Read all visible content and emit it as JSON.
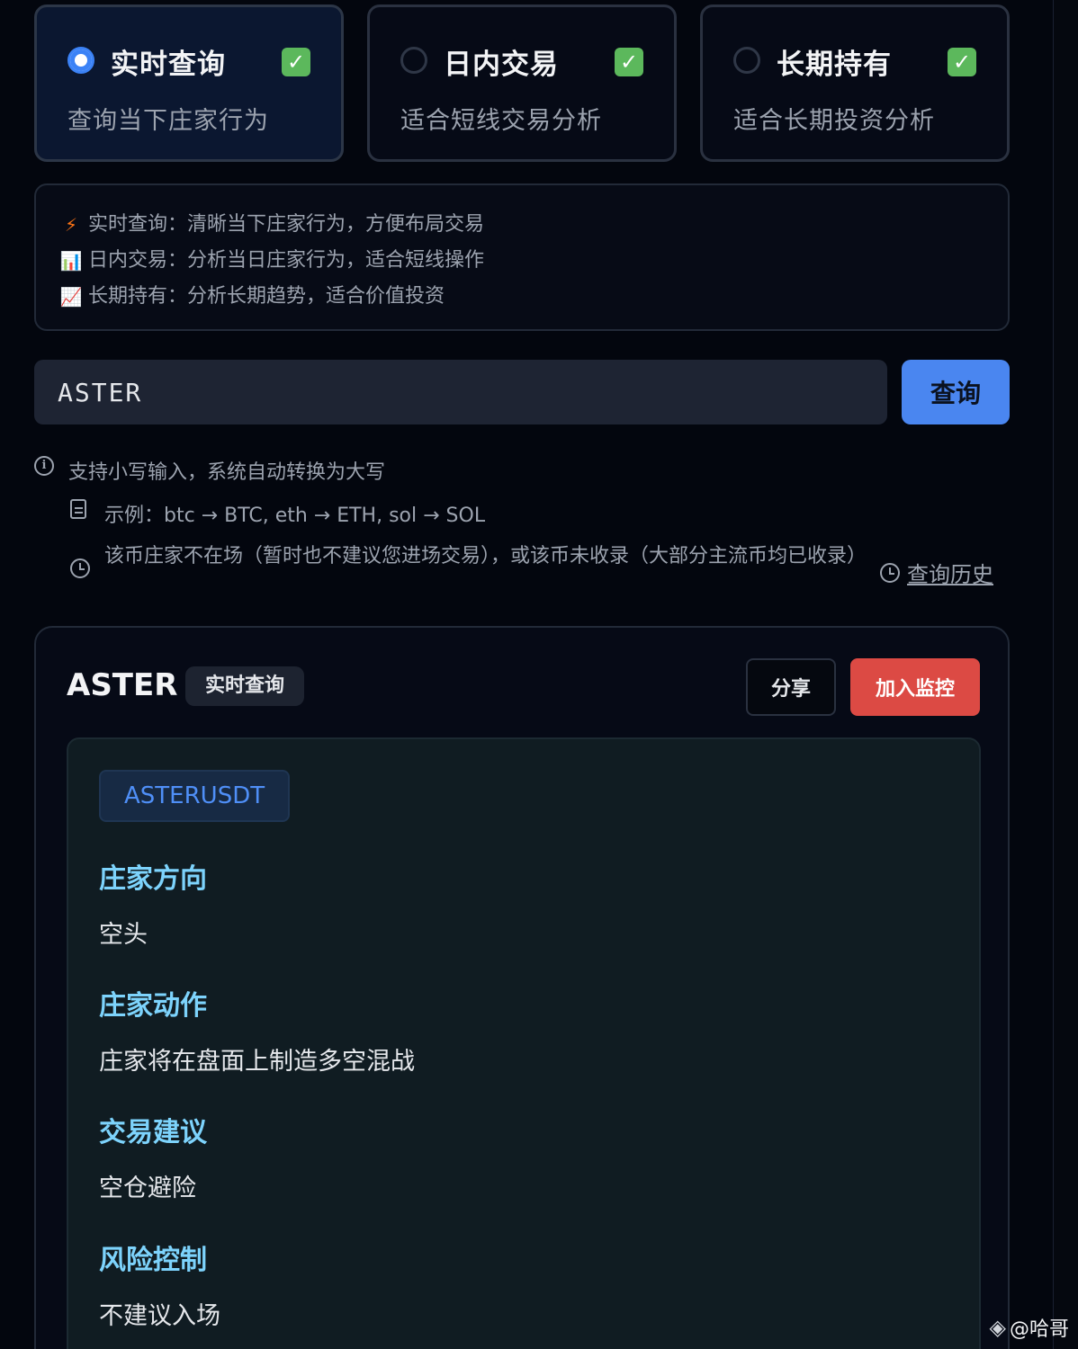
{
  "modes": [
    {
      "title": "实时查询",
      "subtitle": "查询当下庄家行为",
      "check": "✓",
      "selected": true
    },
    {
      "title": "日内交易",
      "subtitle": "适合短线交易分析",
      "check": "✓",
      "selected": false
    },
    {
      "title": "长期持有",
      "subtitle": "适合长期投资分析",
      "check": "✓",
      "selected": false
    }
  ],
  "info": {
    "lines": [
      {
        "icon": "⚡",
        "text": "实时查询：清晰当下庄家行为，方便布局交易"
      },
      {
        "icon": "📊",
        "text": "日内交易：分析当日庄家行为，适合短线操作"
      },
      {
        "icon": "📈",
        "text": "长期持有：分析长期趋势，适合价值投资"
      }
    ]
  },
  "search": {
    "value": "ASTER",
    "button_label": "查询"
  },
  "tips": {
    "lowercase": "支持小写输入，系统自动转换为大写",
    "example": "示例：btc → BTC, eth → ETH, sol → SOL",
    "not_found": "该币庄家不在场（暂时也不建议您进场交易），或该币未收录（大部分主流币均已收录）",
    "history_label": "查询历史"
  },
  "result": {
    "symbol": "ASTER",
    "mode_badge": "实时查询",
    "share_label": "分享",
    "monitor_label": "加入监控",
    "pair": "ASTERUSDT",
    "sections": [
      {
        "title": "庄家方向",
        "body": "空头"
      },
      {
        "title": "庄家动作",
        "body": "庄家将在盘面上制造多空混战"
      },
      {
        "title": "交易建议",
        "body": "空仓避险"
      },
      {
        "title": "风险控制",
        "body": "不建议入场"
      }
    ]
  },
  "watermark": {
    "text": "@哈哥"
  },
  "colors": {
    "accent": "#4a86f0",
    "danger": "#dc4a44",
    "section_title": "#7dd3fc",
    "background": "#03060e"
  }
}
